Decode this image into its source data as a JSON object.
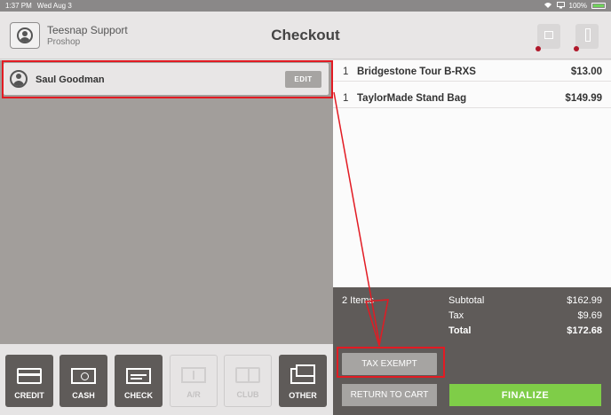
{
  "status_bar": {
    "time": "1:37 PM",
    "date": "Wed Aug 3",
    "battery": "100%"
  },
  "header": {
    "store_name": "Teesnap Support",
    "store_sub": "Proshop",
    "title": "Checkout",
    "icons": [
      "user-icon",
      "printer-icon",
      "cash-drawer-icon"
    ]
  },
  "customer": {
    "name": "Saul Goodman",
    "edit_label": "EDIT"
  },
  "payment_methods": [
    {
      "label": "CREDIT",
      "icon": "credit-card-icon",
      "enabled": true
    },
    {
      "label": "CASH",
      "icon": "cash-icon",
      "enabled": true
    },
    {
      "label": "CHECK",
      "icon": "check-icon",
      "enabled": true
    },
    {
      "label": "A/R",
      "icon": "account-receivable-icon",
      "enabled": false
    },
    {
      "label": "CLUB",
      "icon": "club-icon",
      "enabled": false
    },
    {
      "label": "OTHER",
      "icon": "other-payment-icon",
      "enabled": true
    }
  ],
  "cart": {
    "items": [
      {
        "qty": "1",
        "name": "Bridgestone Tour B-RXS",
        "price": "$13.00"
      },
      {
        "qty": "1",
        "name": "TaylorMade Stand Bag",
        "price": "$149.99"
      }
    ]
  },
  "totals": {
    "items_count": "2 Items",
    "subtotal_label": "Subtotal",
    "subtotal": "$162.99",
    "tax_label": "Tax",
    "tax": "$9.69",
    "total_label": "Total",
    "total": "$172.68"
  },
  "actions": {
    "tax_exempt": "TAX EXEMPT",
    "return_to_cart": "RETURN TO CART",
    "finalize": "FINALIZE"
  },
  "colors": {
    "accent_green": "#7fcd48",
    "annotation_red": "#e21b23",
    "dark_panel": "#5f5b59",
    "indicator_red": "#b0182a"
  }
}
